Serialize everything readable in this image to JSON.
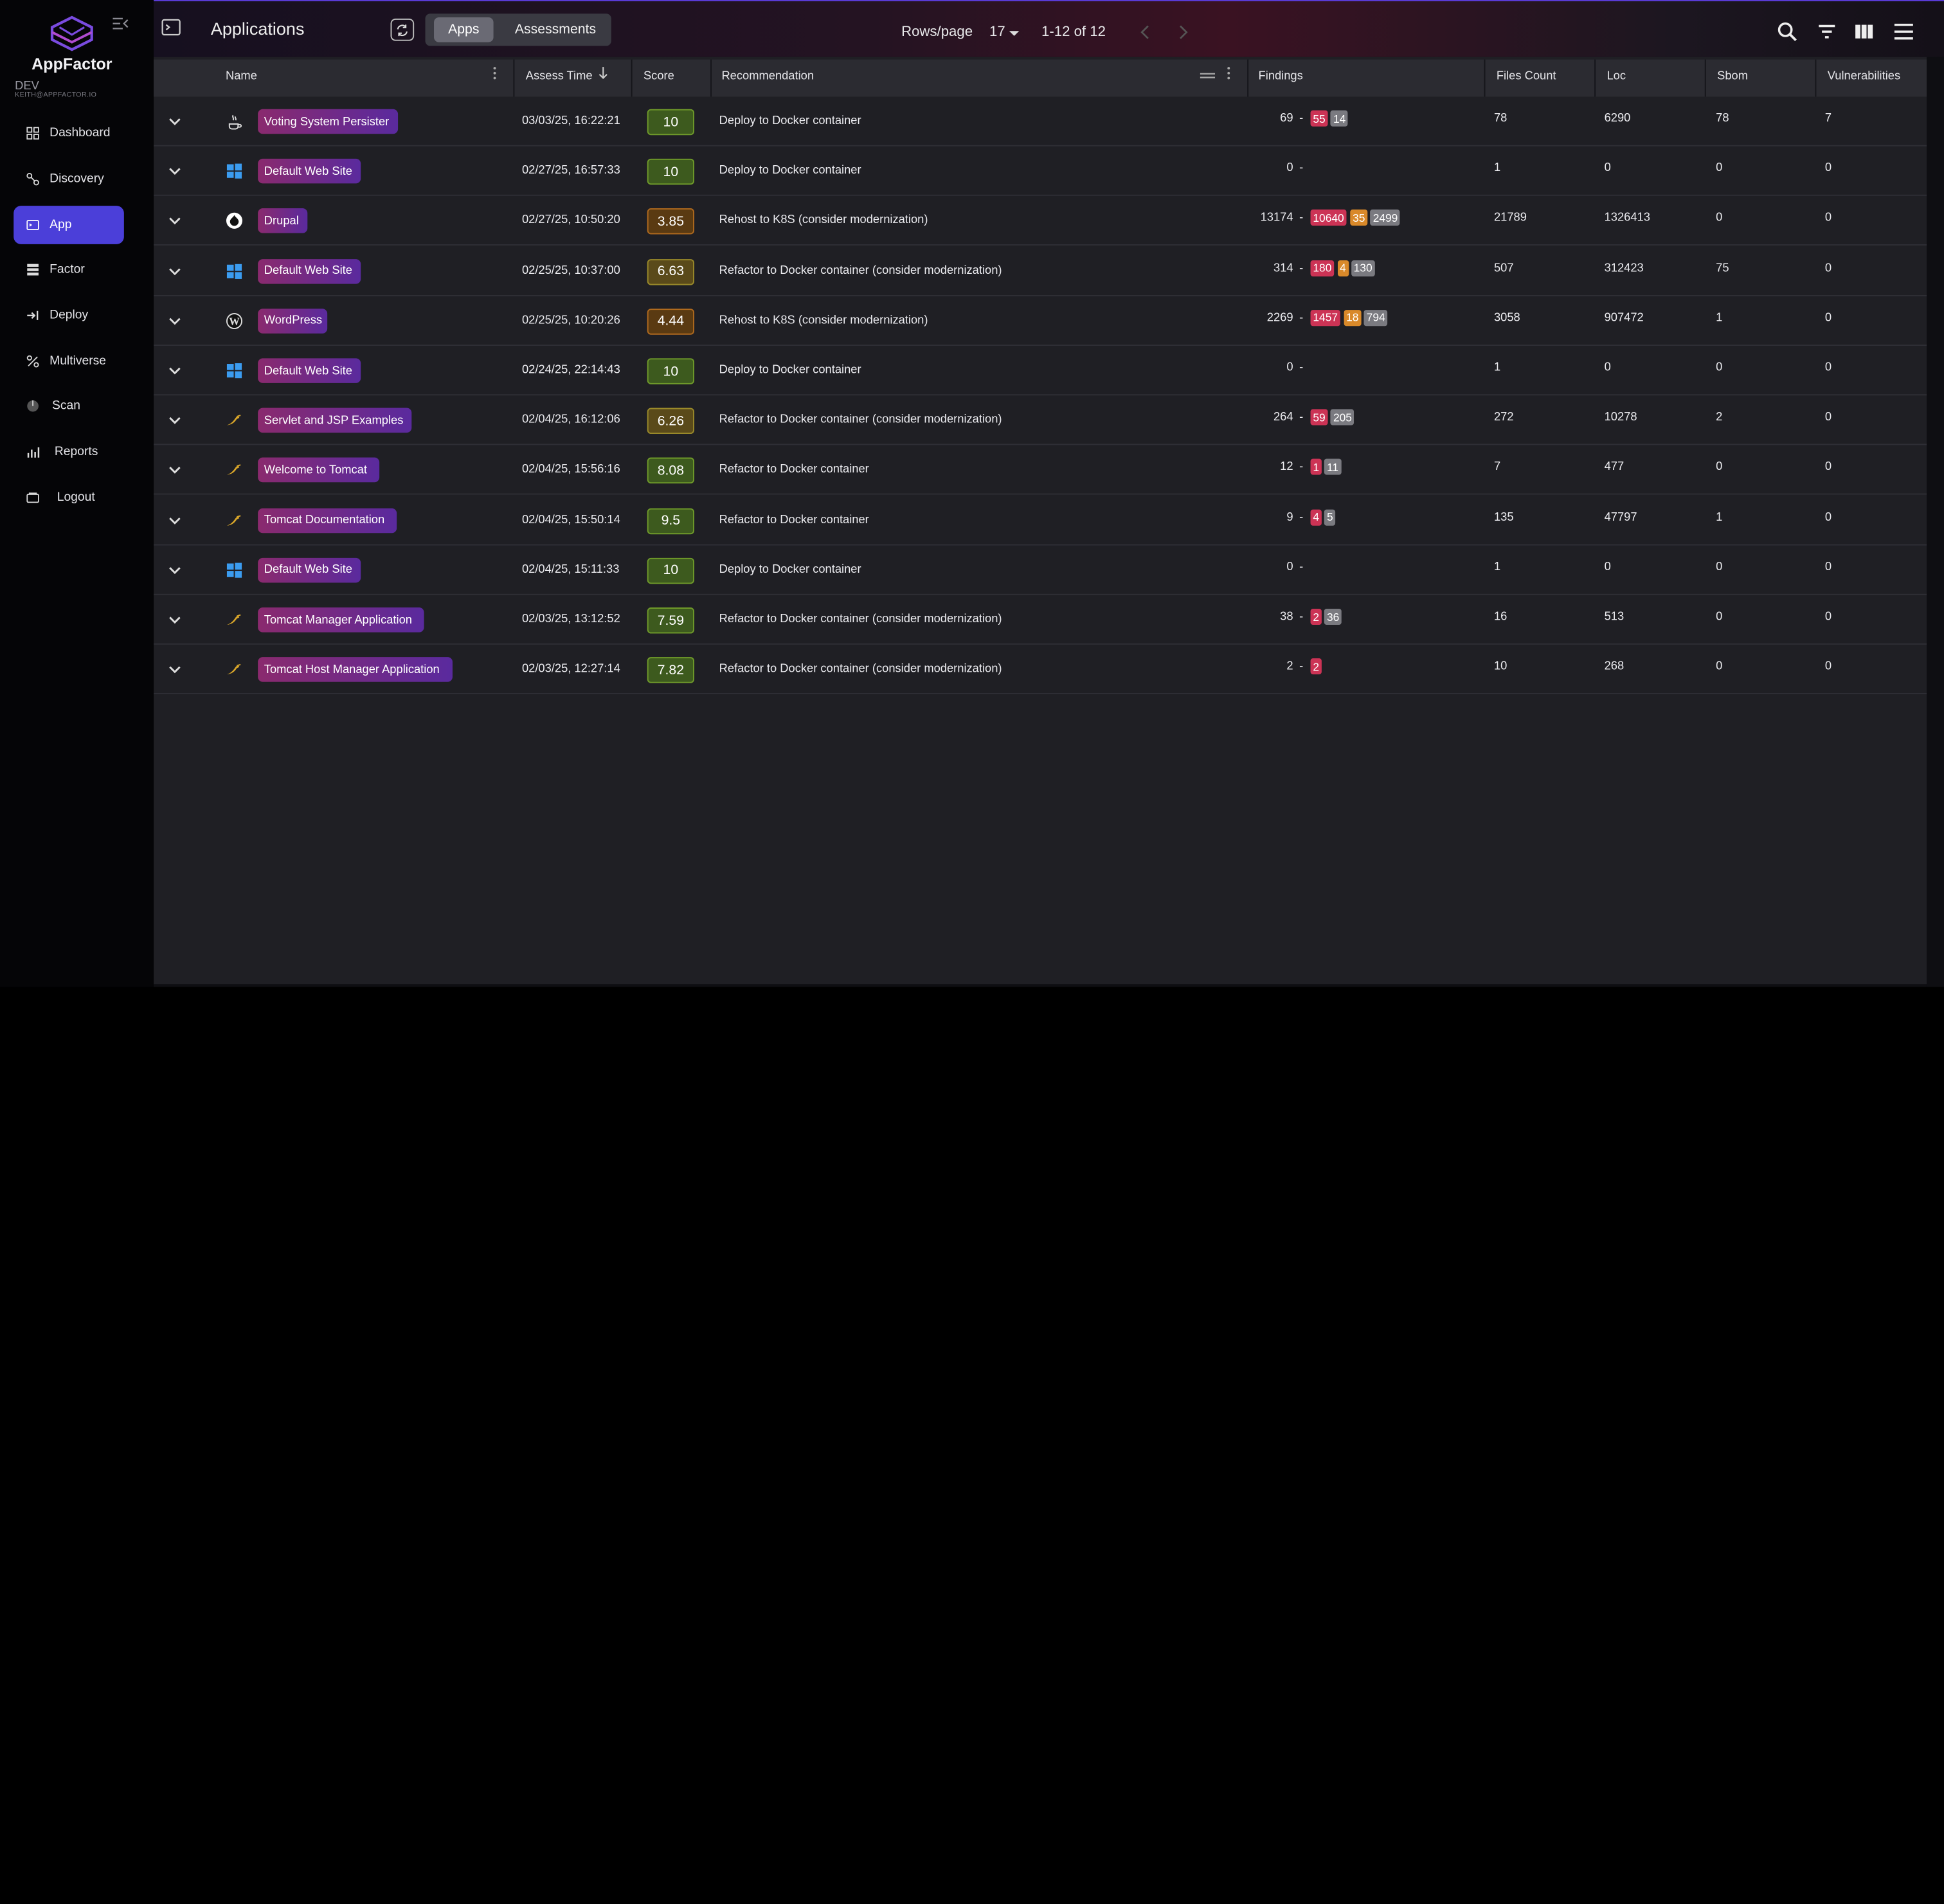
{
  "sidebar": {
    "brand": "AppFactor",
    "env": "DEV",
    "email": "KEITH@APPFACTOR.IO",
    "items": [
      {
        "label": "Dashboard",
        "icon": "dashboard-icon"
      },
      {
        "label": "Discovery",
        "icon": "discovery-icon"
      },
      {
        "label": "App",
        "icon": "app-icon",
        "active": true
      },
      {
        "label": "Factor",
        "icon": "factor-icon"
      },
      {
        "label": "Deploy",
        "icon": "deploy-icon"
      },
      {
        "label": "Multiverse",
        "icon": "multiverse-icon"
      },
      {
        "label": "Scan",
        "icon": "scan-icon"
      },
      {
        "label": "Reports",
        "icon": "reports-icon"
      },
      {
        "label": "Logout",
        "icon": "logout-icon"
      }
    ]
  },
  "topbar": {
    "title": "Applications",
    "tabs": [
      "Apps",
      "Assessments"
    ],
    "active_tab": "Apps",
    "rows_per_page_label": "Rows/page",
    "rows_per_page": "17",
    "range": "1-12 of 12"
  },
  "table": {
    "columns": [
      "Name",
      "Assess Time",
      "Score",
      "Recommendation",
      "Findings",
      "Files Count",
      "Loc",
      "Sbom",
      "Vulnerabilities"
    ],
    "rows": [
      {
        "icon": "java-icon",
        "name": "Voting System Persister",
        "time": "03/03/25, 16:22:21",
        "score": "10",
        "level": "good",
        "rec": "Deploy to Docker container",
        "findings": "69",
        "badges": [
          [
            "55",
            "red"
          ],
          [
            "14",
            "gray"
          ]
        ],
        "files": "78",
        "loc": "6290",
        "sbom": "78",
        "vuln": "7"
      },
      {
        "icon": "windows-icon",
        "name": "Default Web Site",
        "time": "02/27/25, 16:57:33",
        "score": "10",
        "level": "good",
        "rec": "Deploy to Docker container",
        "findings": "0",
        "badges": [],
        "files": "1",
        "loc": "0",
        "sbom": "0",
        "vuln": "0"
      },
      {
        "icon": "drupal-icon",
        "name": "Drupal",
        "time": "02/27/25, 10:50:20",
        "score": "3.85",
        "level": "bad",
        "rec": "Rehost to K8S (consider modernization)",
        "findings": "13174",
        "badges": [
          [
            "10640",
            "red"
          ],
          [
            "35",
            "orange"
          ],
          [
            "2499",
            "gray"
          ]
        ],
        "files": "21789",
        "loc": "1326413",
        "sbom": "0",
        "vuln": "0"
      },
      {
        "icon": "windows-icon",
        "name": "Default Web Site",
        "time": "02/25/25, 10:37:00",
        "score": "6.63",
        "level": "mid",
        "rec": "Refactor to Docker container (consider modernization)",
        "findings": "314",
        "badges": [
          [
            "180",
            "red"
          ],
          [
            "4",
            "orange"
          ],
          [
            "130",
            "gray"
          ]
        ],
        "files": "507",
        "loc": "312423",
        "sbom": "75",
        "vuln": "0"
      },
      {
        "icon": "wordpress-icon",
        "name": "WordPress",
        "time": "02/25/25, 10:20:26",
        "score": "4.44",
        "level": "bad",
        "rec": "Rehost to K8S (consider modernization)",
        "findings": "2269",
        "badges": [
          [
            "1457",
            "red"
          ],
          [
            "18",
            "orange"
          ],
          [
            "794",
            "gray"
          ]
        ],
        "files": "3058",
        "loc": "907472",
        "sbom": "1",
        "vuln": "0"
      },
      {
        "icon": "windows-icon",
        "name": "Default Web Site",
        "time": "02/24/25, 22:14:43",
        "score": "10",
        "level": "good",
        "rec": "Deploy to Docker container",
        "findings": "0",
        "badges": [],
        "files": "1",
        "loc": "0",
        "sbom": "0",
        "vuln": "0"
      },
      {
        "icon": "tomcat-icon",
        "name": "Servlet and JSP Examples",
        "time": "02/04/25, 16:12:06",
        "score": "6.26",
        "level": "mid",
        "rec": "Refactor to Docker container (consider modernization)",
        "findings": "264",
        "badges": [
          [
            "59",
            "red"
          ],
          [
            "205",
            "gray"
          ]
        ],
        "files": "272",
        "loc": "10278",
        "sbom": "2",
        "vuln": "0"
      },
      {
        "icon": "tomcat-icon",
        "name": "Welcome to Tomcat",
        "time": "02/04/25, 15:56:16",
        "score": "8.08",
        "level": "good",
        "rec": "Refactor to Docker container",
        "findings": "12",
        "badges": [
          [
            "1",
            "red"
          ],
          [
            "11",
            "gray"
          ]
        ],
        "files": "7",
        "loc": "477",
        "sbom": "0",
        "vuln": "0"
      },
      {
        "icon": "tomcat-icon",
        "name": "Tomcat Documentation",
        "time": "02/04/25, 15:50:14",
        "score": "9.5",
        "level": "good",
        "rec": "Refactor to Docker container",
        "findings": "9",
        "badges": [
          [
            "4",
            "red"
          ],
          [
            "5",
            "gray"
          ]
        ],
        "files": "135",
        "loc": "47797",
        "sbom": "1",
        "vuln": "0"
      },
      {
        "icon": "windows-icon",
        "name": "Default Web Site",
        "time": "02/04/25, 15:11:33",
        "score": "10",
        "level": "good",
        "rec": "Deploy to Docker container",
        "findings": "0",
        "badges": [],
        "files": "1",
        "loc": "0",
        "sbom": "0",
        "vuln": "0"
      },
      {
        "icon": "tomcat-icon",
        "name": "Tomcat Manager Application",
        "time": "02/03/25, 13:12:52",
        "score": "7.59",
        "level": "good",
        "rec": "Refactor to Docker container (consider modernization)",
        "findings": "38",
        "badges": [
          [
            "2",
            "red"
          ],
          [
            "36",
            "gray"
          ]
        ],
        "files": "16",
        "loc": "513",
        "sbom": "0",
        "vuln": "0"
      },
      {
        "icon": "tomcat-icon",
        "name": "Tomcat Host Manager Application",
        "time": "02/03/25, 12:27:14",
        "score": "7.82",
        "level": "good",
        "rec": "Refactor to Docker container (consider modernization)",
        "findings": "2",
        "badges": [
          [
            "2",
            "red"
          ]
        ],
        "files": "10",
        "loc": "268",
        "sbom": "0",
        "vuln": "0"
      }
    ]
  },
  "colors": {
    "accent": "#4b3fd9",
    "score_good_bg": "#3d5a1e",
    "score_good_border": "#6f9a2a",
    "score_mid_bg": "#5a4a1a",
    "score_mid_border": "#9a8a2a",
    "score_bad_bg": "#5a3a12",
    "score_bad_border": "#b06a1e"
  }
}
